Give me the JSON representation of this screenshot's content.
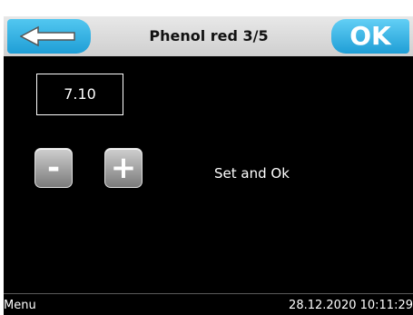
{
  "header": {
    "back_icon": "left-arrow-icon",
    "title": "Phenol red 3/5",
    "ok_label": "OK"
  },
  "main": {
    "value": "7.10",
    "minus_label": "-",
    "plus_label": "+",
    "instruction": "Set and Ok"
  },
  "footer": {
    "menu_label": "Menu",
    "datetime": "28.12.2020 10:11:29"
  },
  "colors": {
    "accent": "#1f9ed6",
    "background": "#000000",
    "header": "#d9d9d9",
    "button_gray": "#9a9a9a"
  }
}
